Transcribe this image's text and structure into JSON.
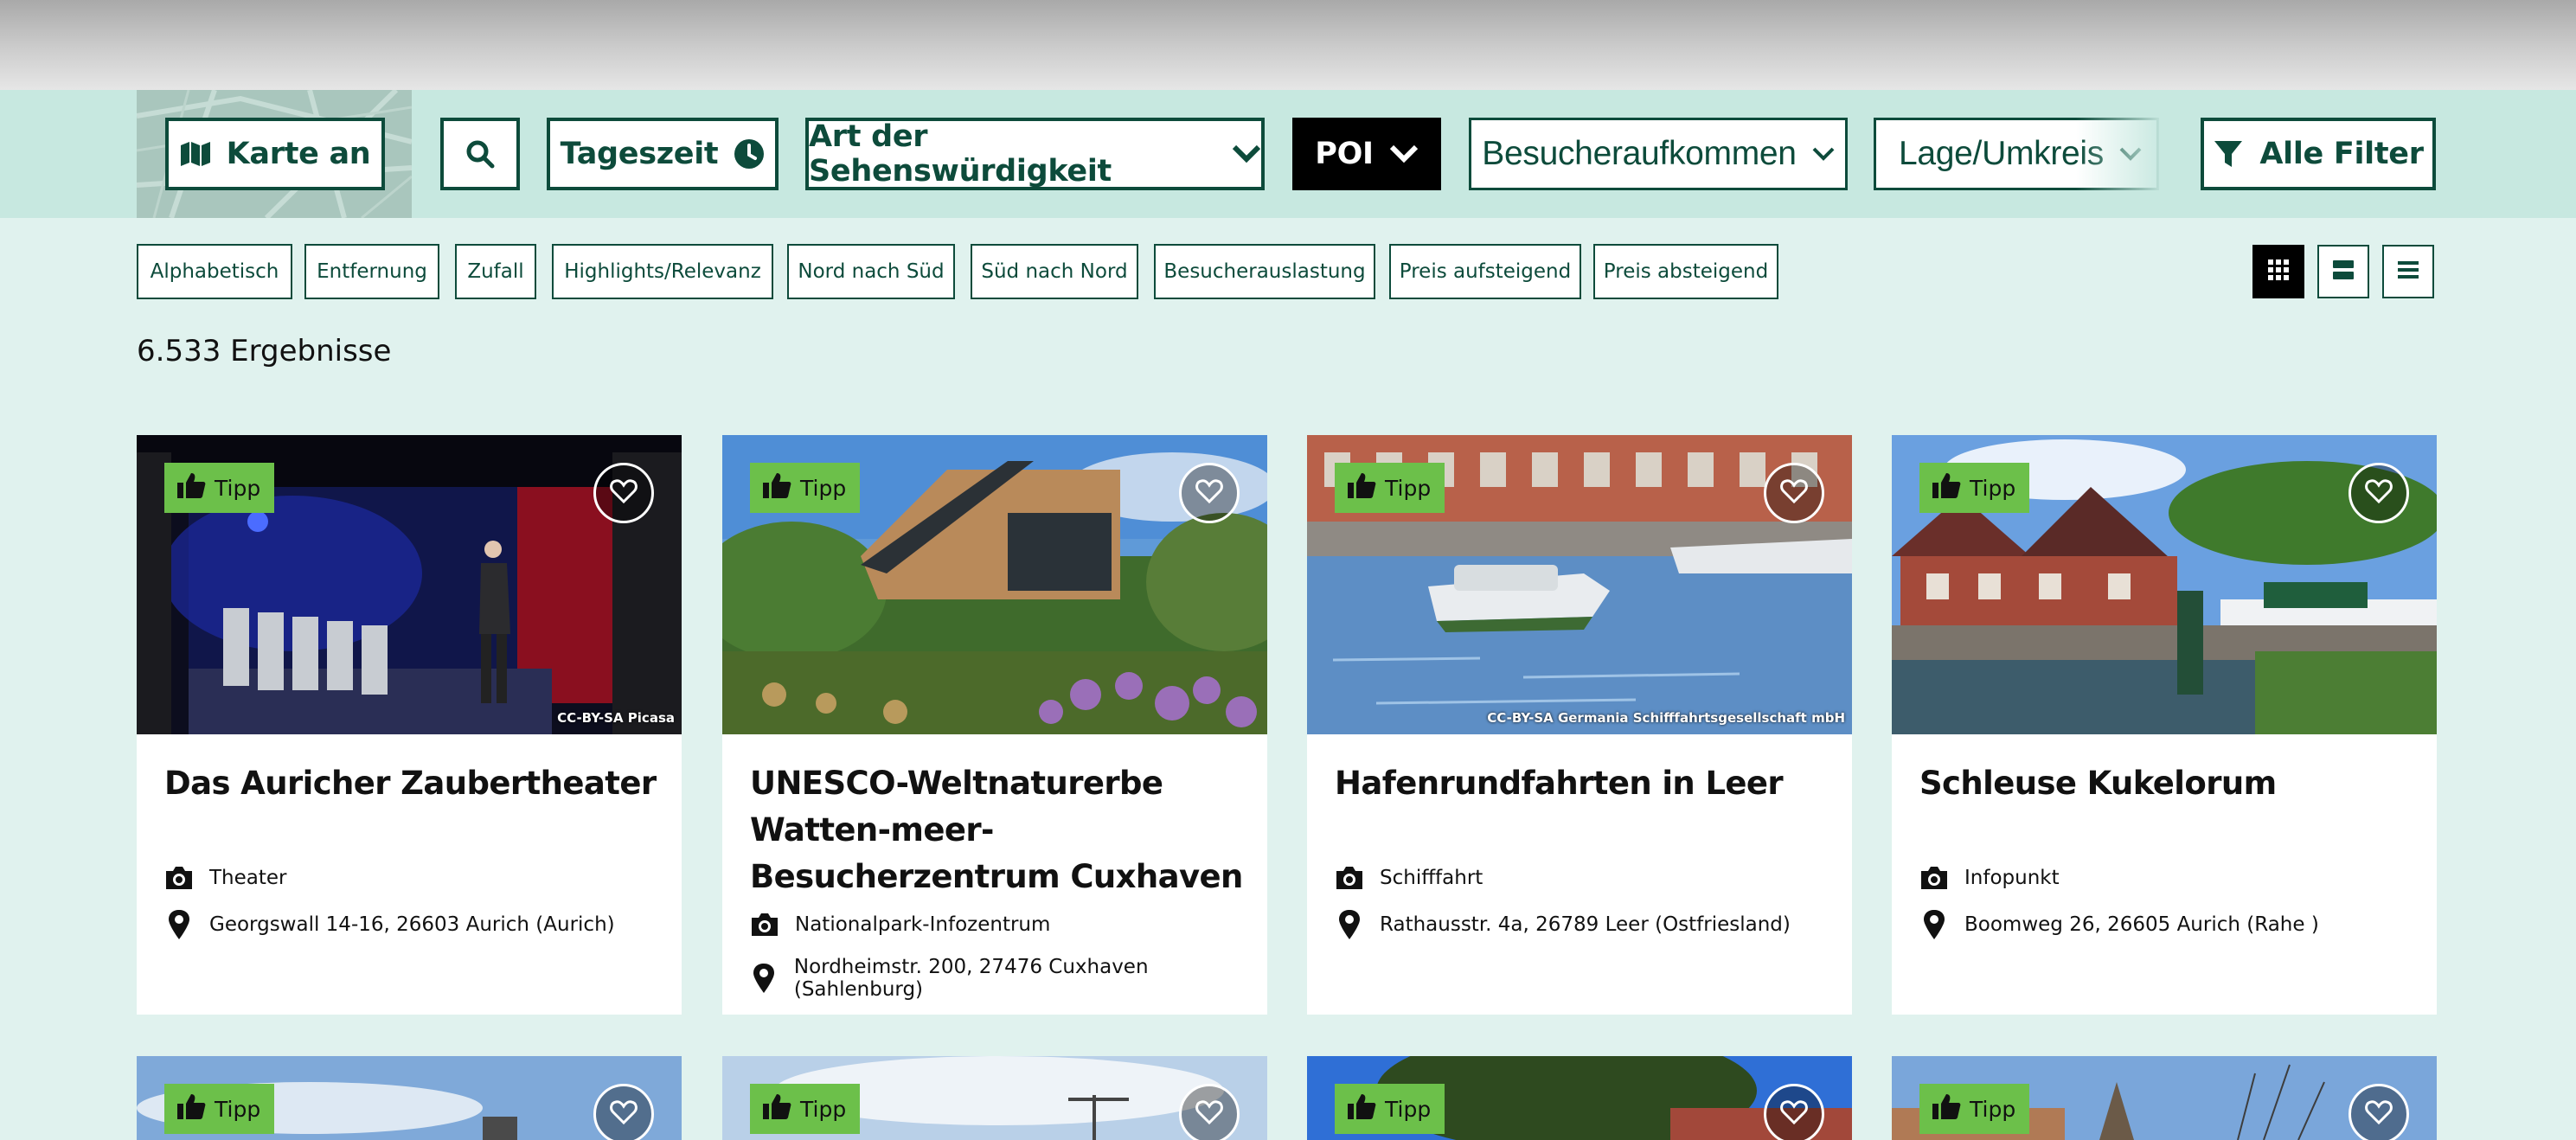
{
  "filters": {
    "map_toggle": "Karte an",
    "time_of_day": "Tageszeit",
    "sight_type": "Art der Sehenswürdigkeit",
    "poi": "POI",
    "visitor_volume": "Besucheraufkommen",
    "location": "Lage/Umkreis",
    "all_filters": "Alle Filter"
  },
  "sort_options": [
    "Alphabetisch",
    "Entfernung",
    "Zufall",
    "Highlights/Relevanz",
    "Nord nach Süd",
    "Süd nach Nord",
    "Besucherauslastung",
    "Preis aufsteigend",
    "Preis absteigend"
  ],
  "results_count": "6.533 Ergebnisse",
  "tipp_label": "Tipp",
  "cards": [
    {
      "title": "Das Auricher Zaubertheater",
      "category": "Theater",
      "address": "Georgswall 14-16, 26603 Aurich (Aurich)",
      "credit": "CC-BY-SA Picasa"
    },
    {
      "title": "UNESCO-Weltnaturerbe Watten-meer-Besucherzentrum Cuxhaven",
      "category": "Nationalpark-Infozentrum",
      "address": "Nordheimstr. 200, 27476 Cuxhaven (Sahlenburg)",
      "credit": ""
    },
    {
      "title": "Hafenrundfahrten in Leer",
      "category": "Schifffahrt",
      "address": "Rathausstr. 4a, 26789 Leer (Ostfriesland)",
      "credit": "CC-BY-SA Germania Schifffahrtsgesellschaft mbH"
    },
    {
      "title": "Schleuse Kukelorum",
      "category": "Infopunkt",
      "address": "Boomweg 26, 26605 Aurich (Rahe )",
      "credit": ""
    }
  ],
  "colors": {
    "brand_green": "#0d4b3b",
    "tipp_green": "#6cc04a",
    "filter_bg": "#c7e8e0",
    "page_bg": "#e0f2ee"
  },
  "icons": [
    "map-icon",
    "search-icon",
    "clock-icon",
    "chevron-down-icon",
    "filter-icon",
    "grid-view-icon",
    "card-view-icon",
    "list-view-icon",
    "thumbs-up-icon",
    "heart-icon",
    "camera-icon",
    "location-pin-icon"
  ]
}
